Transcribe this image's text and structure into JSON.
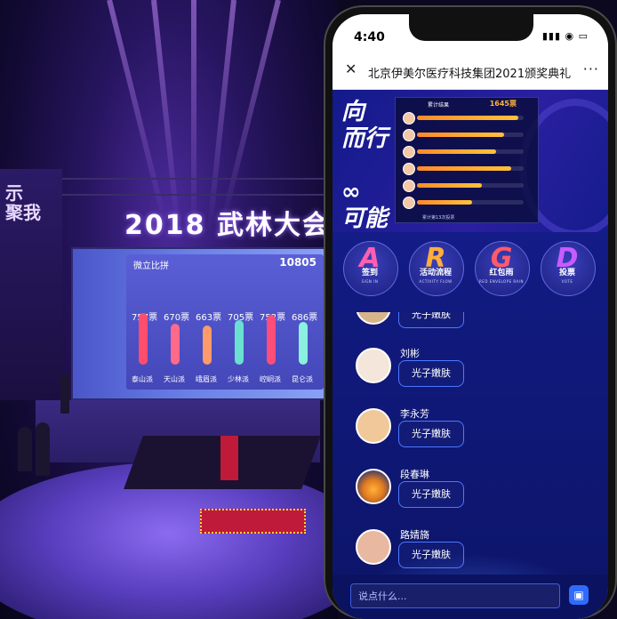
{
  "stage": {
    "title": "2018 武林大会",
    "left_sign": "示\n聚我",
    "screen": {
      "header": "微立比拼",
      "total": "10805",
      "votes": [
        "757票",
        "670票",
        "663票",
        "705票",
        "752票",
        "686票"
      ],
      "teams": [
        "泰山派",
        "天山派",
        "峨眉派",
        "少林派",
        "崆峒派",
        "昆仑派"
      ]
    }
  },
  "phone": {
    "status": {
      "time": "4:40",
      "icons": "▮▮▮ ◉ ▭"
    },
    "nav": {
      "close": "✕",
      "title": "北京伊美尔医疗科技集团2021颁奖典礼",
      "more": "···"
    },
    "banner": {
      "art_text": "向\n而行\n\n∞\n可能",
      "leaderboard": {
        "header": "累计结果",
        "total": "1645票",
        "footer": "累计第13次投票",
        "rows": [
          {
            "value": 0.95
          },
          {
            "value": 0.82
          },
          {
            "value": 0.74
          },
          {
            "value": 0.88
          },
          {
            "value": 0.61
          },
          {
            "value": 0.52
          }
        ]
      }
    },
    "menu": [
      {
        "letter": "A",
        "label": "签到",
        "sub": "SIGN IN",
        "color": "#ff5fb0"
      },
      {
        "letter": "R",
        "label": "活动流程",
        "sub": "ACTIVITY FLOW",
        "color": "#ffae3a"
      },
      {
        "letter": "G",
        "label": "红包雨",
        "sub": "RED ENVELOPE RAIN",
        "color": "#ff5a6a"
      },
      {
        "letter": "D",
        "label": "投票",
        "sub": "VOTE",
        "color": "#c65cff"
      }
    ],
    "chat": [
      {
        "name": "",
        "message": "光子嫩肤"
      },
      {
        "name": "刘彬",
        "message": "光子嫩肤"
      },
      {
        "name": "李永芳",
        "message": "光子嫩肤"
      },
      {
        "name": "段春琳",
        "message": "光子嫩肤"
      },
      {
        "name": "路婧旖",
        "message": "光子嫩肤"
      }
    ],
    "input": {
      "placeholder": "说点什么..."
    }
  }
}
